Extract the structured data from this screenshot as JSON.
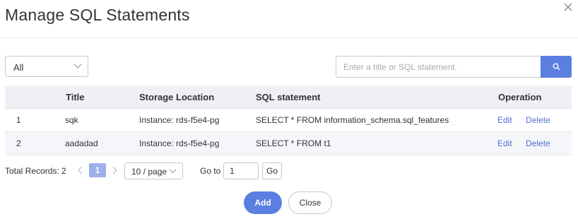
{
  "dialog": {
    "title": "Manage SQL Statements",
    "close_icon": "close-icon"
  },
  "filter": {
    "selected": "All",
    "icon": "chevron-down-icon"
  },
  "search": {
    "placeholder": "Enter a title or SQL statement.",
    "value": "",
    "icon": "search-icon",
    "accent": "#5b7fe0"
  },
  "table": {
    "columns": [
      "",
      "Title",
      "Storage Location",
      "SQL statement",
      "Operation"
    ],
    "rows": [
      {
        "index": "1",
        "title": "sqk",
        "storage_location": "Instance: rds-f5e4-pg",
        "sql": "SELECT * FROM information_schema.sql_features",
        "edit": "Edit",
        "delete": "Delete"
      },
      {
        "index": "2",
        "title": "aadadad",
        "storage_location": "Instance: rds-f5e4-pg",
        "sql": "SELECT * FROM t1",
        "edit": "Edit",
        "delete": "Delete"
      }
    ],
    "link_color": "#4e71d3"
  },
  "pagination": {
    "total_label": "Total Records: 2",
    "current_page": "1",
    "page_size": "10 / page",
    "goto_label": "Go to",
    "goto_value": "1",
    "go_label": "Go"
  },
  "footer": {
    "add_label": "Add",
    "close_label": "Close"
  }
}
